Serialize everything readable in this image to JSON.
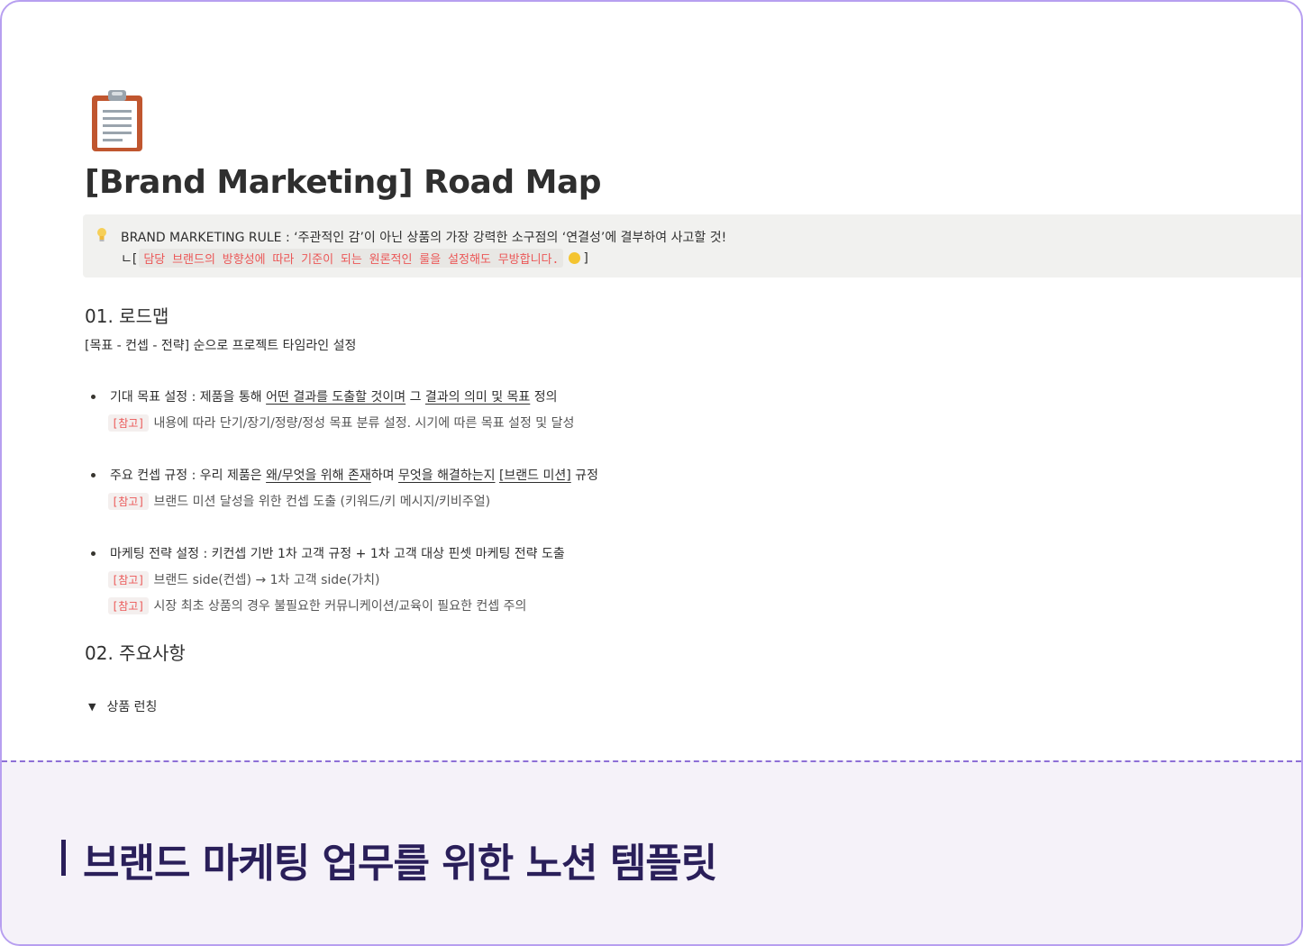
{
  "page": {
    "icon": "clipboard-icon",
    "title": "[Brand Marketing] Road Map"
  },
  "callout": {
    "icon": "lightbulb-icon",
    "line1": "BRAND MARKETING RULE : ‘주관적인 감’이 아닌 상품의 가장 강력한 소구점의 ‘연결성’에 결부하여 사고할 것!",
    "line2_prefix": "ㄴ[",
    "line2_code": "담당 브랜드의 방향성에 따라 기준이 되는 원론적인 룰을 설정해도 무방합니다.",
    "line2_suffix": "]",
    "emoji": "smiley-icon"
  },
  "section1": {
    "heading": "01. 로드맵",
    "subtext": "[목표 - 컨셉 - 전략] 순으로 프로젝트 타임라인 설정",
    "items": [
      {
        "parts": [
          {
            "text": "기대 목표 설정 : 제품을 통해 ",
            "u": false
          },
          {
            "text": "어떤 결과를 도출할 것이며",
            "u": true
          },
          {
            "text": " 그 ",
            "u": false
          },
          {
            "text": "결과의 의미 및 목표",
            "u": true
          },
          {
            "text": " 정의",
            "u": false
          }
        ],
        "notes": [
          {
            "tag": "[참고]",
            "text": "내용에 따라 단기/장기/정량/정성 목표 분류 설정. 시기에 따른 목표 설정 및 달성"
          }
        ]
      },
      {
        "parts": [
          {
            "text": "주요 컨셉 규정 : 우리 제품은 ",
            "u": false
          },
          {
            "text": "왜/무엇을 위해 존재",
            "u": true
          },
          {
            "text": "하며 ",
            "u": false
          },
          {
            "text": "무엇을 해결하는지",
            "u": true
          },
          {
            "text": " ",
            "u": false
          },
          {
            "text": "[브랜드 미션]",
            "u": true
          },
          {
            "text": " 규정",
            "u": false
          }
        ],
        "notes": [
          {
            "tag": "[참고]",
            "text": "브랜드 미션 달성을 위한 컨셉 도출 (키워드/키 메시지/키비주얼)"
          }
        ]
      },
      {
        "parts": [
          {
            "text": "마케팅 전략 설정 : 키컨셉 기반 1차 고객 규정 + 1차 고객 대상 핀셋 마케팅 전략 도출",
            "u": false
          }
        ],
        "notes": [
          {
            "tag": "[참고]",
            "text": "브랜드 side(컨셉) → 1차 고객 side(가치)"
          },
          {
            "tag": "[참고]",
            "text": "시장 최초 상품의 경우 불필요한 커뮤니케이션/교육이 필요한 컨셉 주의"
          }
        ]
      }
    ]
  },
  "section2": {
    "heading": "02. 주요사항",
    "toggle_arrow": "▼",
    "toggle_label": "상품 런칭"
  },
  "banner": {
    "text": "브랜드 마케팅 업무를 위한 노션 템플릿"
  },
  "colors": {
    "frame_border": "#b79ff0",
    "banner_bg": "#f5f2f9",
    "banner_text": "#2a1f5a",
    "code_red": "#eb5757",
    "callout_bg": "#f1f1ef"
  }
}
